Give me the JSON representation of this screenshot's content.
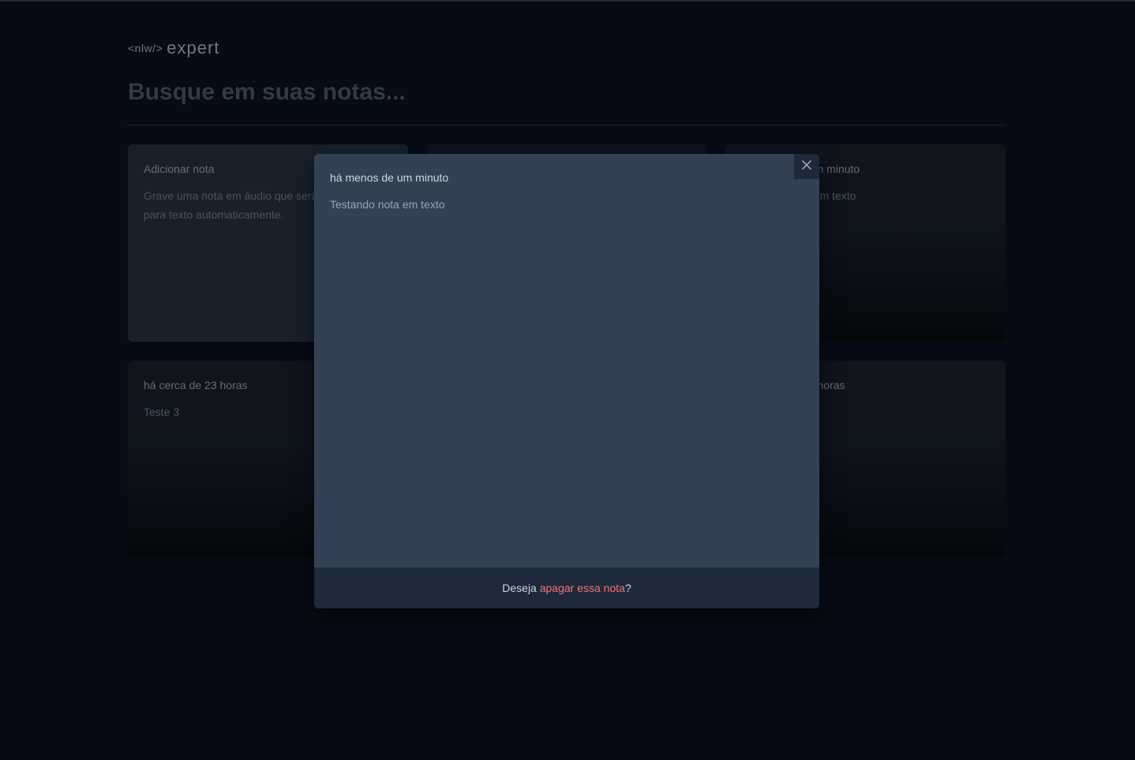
{
  "logo": {
    "prefix": "<nlw/>",
    "suffix": "expert"
  },
  "search": {
    "placeholder": "Busque em suas notas..."
  },
  "cards": [
    {
      "title": "Adicionar nota",
      "body": "Grave uma nota em áudio que será convertida para texto automaticamente."
    },
    {
      "title": "",
      "body": ""
    },
    {
      "title": "há menos de um minuto",
      "body": "Testando nota em texto"
    },
    {
      "title": "há cerca de 23 horas",
      "body": "Teste 3"
    },
    {
      "title": "",
      "body": ""
    },
    {
      "title": "há cerca de 23 horas",
      "body": ""
    }
  ],
  "modal": {
    "title": "há menos de um minuto",
    "body": "Testando nota em texto",
    "footer_prefix": "Deseja ",
    "footer_link": "apagar essa nota",
    "footer_suffix": "?"
  },
  "colors": {
    "background": "#0f172a",
    "danger": "#f87171"
  },
  "icons": {
    "close": "x-icon"
  }
}
